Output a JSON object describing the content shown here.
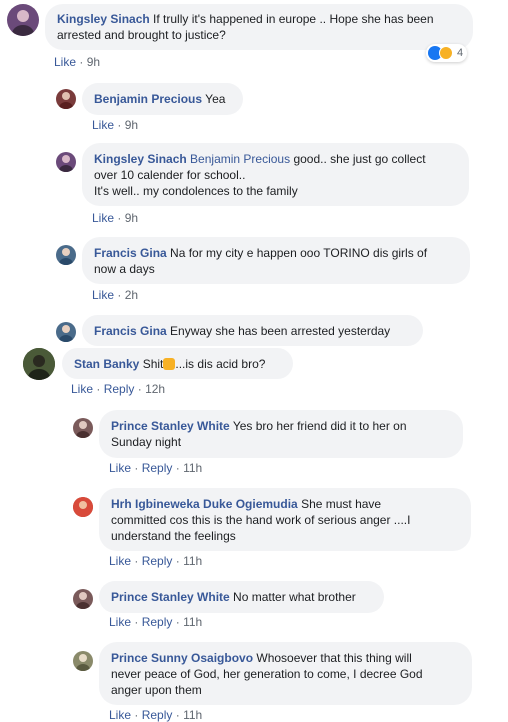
{
  "comments": [
    {
      "author": "Kingsley Sinach",
      "mention": "",
      "text": "If trully it's happened in europe .. Hope she has been arrested and brought to justice?",
      "line1": "If trully it's happened in europe .. Hope she has been",
      "line2": "arrested and brought to justice?",
      "actions": {
        "like": "Like",
        "time": "9h"
      },
      "reaction_count": "4",
      "avatar_color": "#6b4a7a"
    },
    {
      "author": "Benjamin Precious",
      "text": "Yea",
      "actions": {
        "like": "Like",
        "time": "9h"
      },
      "avatar_color": "#7a3b3b"
    },
    {
      "author": "Kingsley Sinach",
      "mention": "Benjamin Precious",
      "line1": "good.. she just go collect",
      "line2": "over 10 calender for school..",
      "line3": "It's well.. my condolences to the family",
      "actions": {
        "like": "Like",
        "time": "9h"
      },
      "avatar_color": "#6b4a7a"
    },
    {
      "author": "Francis Gina",
      "line1": "Na for my city e happen ooo TORINO dis girls of",
      "line2": "now a days",
      "actions": {
        "like": "Like",
        "time": "2h"
      },
      "avatar_color": "#4a6b8a"
    },
    {
      "author": "Francis Gina",
      "text": "Enyway she has been arrested yesterday",
      "avatar_color": "#4a6b8a"
    },
    {
      "author": "Stan Banky",
      "text_a": "Shit",
      "text_b": "...is dis acid bro?",
      "actions": {
        "like": "Like",
        "reply": "Reply",
        "time": "12h"
      },
      "avatar_color": "#3d4a2e"
    },
    {
      "author": "Prince Stanley White",
      "line1": "Yes bro her friend did it to her on",
      "line2": "Sunday night",
      "actions": {
        "like": "Like",
        "reply": "Reply",
        "time": "11h"
      },
      "avatar_color": "#7a5a5a"
    },
    {
      "author": "Hrh Igbineweka Duke Ogiemudia",
      "line1": "She must have",
      "line2": "committed cos this is the hand work of serious anger ....I",
      "line3": "understand the feelings",
      "actions": {
        "like": "Like",
        "reply": "Reply",
        "time": "11h"
      },
      "avatar_color": "#c0392b"
    },
    {
      "author": "Prince Stanley White",
      "text": "No matter what brother",
      "actions": {
        "like": "Like",
        "reply": "Reply",
        "time": "11h"
      },
      "avatar_color": "#7a5a5a"
    },
    {
      "author": "Prince Sunny Osaigbovo",
      "line1": "Whosoever that this thing will",
      "line2": "never peace of God, her generation to come, I decree God",
      "line3": "anger upon them",
      "actions": {
        "like": "Like",
        "reply": "Reply",
        "time": "11h"
      },
      "avatar_color": "#8a8a6a"
    }
  ],
  "separator": "·"
}
